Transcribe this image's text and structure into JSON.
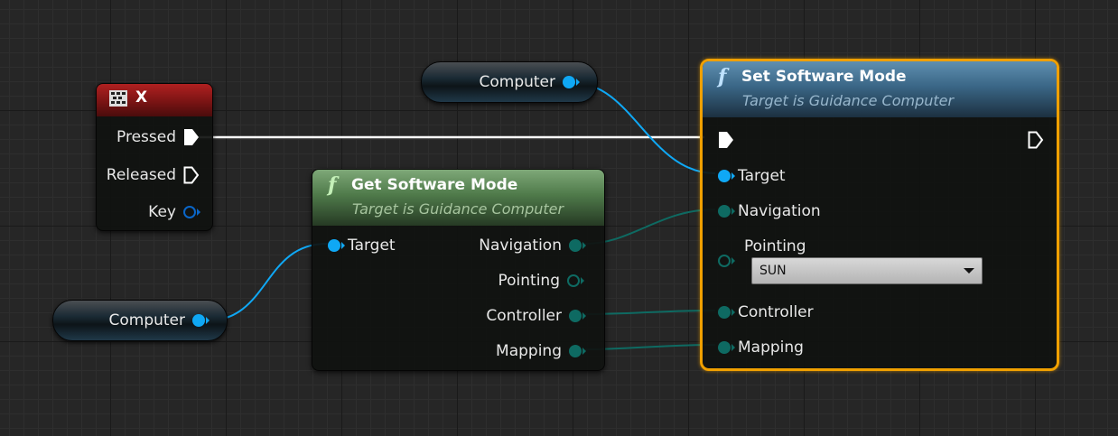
{
  "input_event_node": {
    "title": "X",
    "icon": "keyboard-icon",
    "header_color": "#8a1a1a",
    "pins": {
      "pressed": "Pressed",
      "released": "Released",
      "key": "Key"
    }
  },
  "variable_nodes": [
    {
      "label": "Computer"
    },
    {
      "label": "Computer"
    }
  ],
  "get_node": {
    "title": "Get Software Mode",
    "subtitle": "Target is Guidance Computer",
    "header_color": "#5e8a5a",
    "inputs": {
      "target": "Target"
    },
    "outputs": {
      "navigation": "Navigation",
      "pointing": "Pointing",
      "controller": "Controller",
      "mapping": "Mapping"
    }
  },
  "set_node": {
    "title": "Set Software Mode",
    "subtitle": "Target is Guidance Computer",
    "header_color": "#3c6a88",
    "selection_color": "#f0a000",
    "inputs": {
      "target": "Target",
      "navigation": "Navigation",
      "pointing": "Pointing",
      "controller": "Controller",
      "mapping": "Mapping"
    },
    "pointing_dropdown": {
      "value": "SUN"
    }
  },
  "colors": {
    "object_pin": "#0fa8f5",
    "struct_pin": "#0e6a62",
    "exec_pin": "#ffffff",
    "background": "#262626"
  }
}
